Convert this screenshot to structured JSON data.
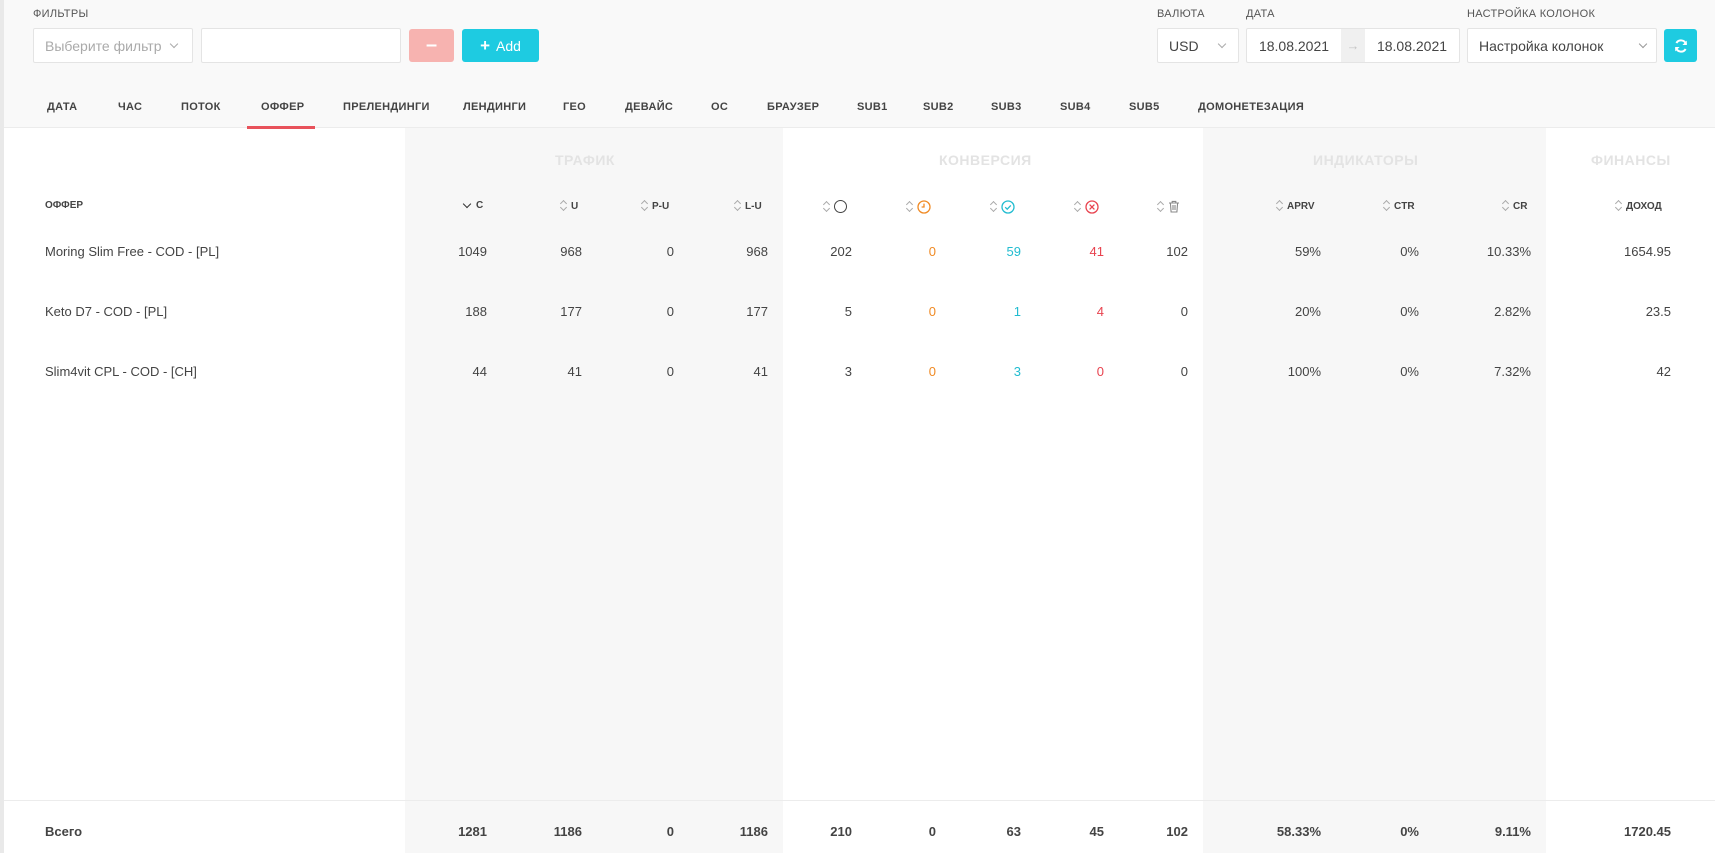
{
  "filters": {
    "label": "ФИЛЬТРЫ",
    "select_placeholder": "Выберите фильтр",
    "value_input": "",
    "remove_label": "–",
    "add_label": "Add"
  },
  "currency": {
    "label": "ВАЛЮТА",
    "value": "USD"
  },
  "date": {
    "label": "ДАТА",
    "from": "18.08.2021",
    "to": "18.08.2021",
    "arrow": "→"
  },
  "columns_setting": {
    "label": "НАСТРОЙКА КОЛОНОК",
    "value": "Настройка колонок"
  },
  "tabs": [
    {
      "label": "ДАТА"
    },
    {
      "label": "ЧАС"
    },
    {
      "label": "ПОТОК"
    },
    {
      "label": "ОФФЕР",
      "active": true
    },
    {
      "label": "ПРЕЛЕНДИНГИ"
    },
    {
      "label": "ЛЕНДИНГИ"
    },
    {
      "label": "ГЕО"
    },
    {
      "label": "ДЕВАЙС"
    },
    {
      "label": "ОС"
    },
    {
      "label": "БРАУЗЕР"
    },
    {
      "label": "SUB1"
    },
    {
      "label": "SUB2"
    },
    {
      "label": "SUB3"
    },
    {
      "label": "SUB4"
    },
    {
      "label": "SUB5"
    },
    {
      "label": "ДОМОНЕТЕЗАЦИЯ"
    }
  ],
  "groups": {
    "traffic": "ТРАФИК",
    "conversion": "КОНВЕРСИЯ",
    "indicators": "ИНДИКАТОРЫ",
    "finance": "ФИНАНСЫ"
  },
  "columns": {
    "offer": "ОФФЕР",
    "c": "C",
    "u": "U",
    "pu": "P-U",
    "lu": "L-U",
    "all_icon": "circle-icon",
    "hold_icon": "clock-icon",
    "approved_icon": "check-circle-icon",
    "rejected_icon": "x-circle-icon",
    "trash_icon": "trash-icon",
    "aprv": "APRV",
    "ctr": "CTR",
    "cr": "CR",
    "income": "ДОХОД"
  },
  "rows": [
    {
      "offer": "Moring Slim Free - COD - [PL]",
      "c": "1049",
      "u": "968",
      "pu": "0",
      "lu": "968",
      "all": "202",
      "hold": "0",
      "approved": "59",
      "rejected": "41",
      "trash": "102",
      "aprv": "59%",
      "ctr": "0%",
      "cr": "10.33%",
      "income": "1654.95"
    },
    {
      "offer": "Keto D7 - COD - [PL]",
      "c": "188",
      "u": "177",
      "pu": "0",
      "lu": "177",
      "all": "5",
      "hold": "0",
      "approved": "1",
      "rejected": "4",
      "trash": "0",
      "aprv": "20%",
      "ctr": "0%",
      "cr": "2.82%",
      "income": "23.5"
    },
    {
      "offer": "Slim4vit CPL - COD - [CH]",
      "c": "44",
      "u": "41",
      "pu": "0",
      "lu": "41",
      "all": "3",
      "hold": "0",
      "approved": "3",
      "rejected": "0",
      "trash": "0",
      "aprv": "100%",
      "ctr": "0%",
      "cr": "7.32%",
      "income": "42"
    }
  ],
  "totals": {
    "label": "Всего",
    "c": "1281",
    "u": "1186",
    "pu": "0",
    "lu": "1186",
    "all": "210",
    "hold": "0",
    "approved": "63",
    "rejected": "45",
    "trash": "102",
    "aprv": "58.33%",
    "ctr": "0%",
    "cr": "9.11%",
    "income": "1720.45"
  },
  "colors": {
    "accent": "#1ecbe1",
    "danger": "#f7b3b0",
    "hold": "#f08a24",
    "approved": "#22bcd0",
    "rejected": "#e8434f",
    "active_tab": "#e8525b"
  }
}
